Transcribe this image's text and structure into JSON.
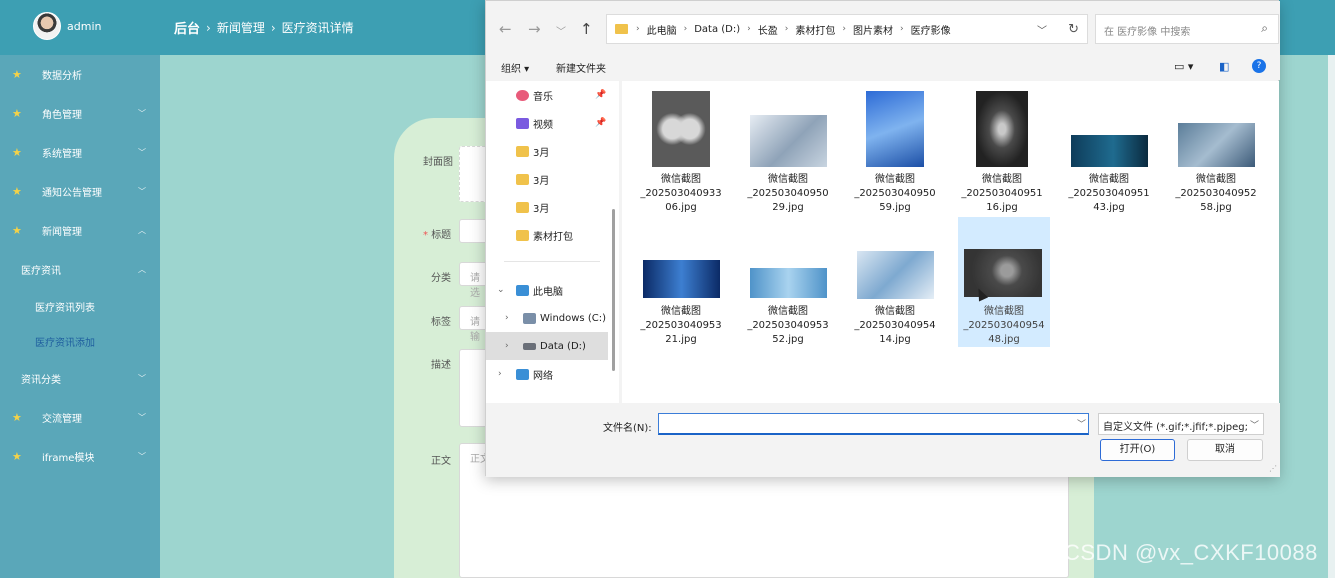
{
  "app": {
    "user_name": "admin",
    "breadcrumb": [
      "后台",
      "新闻管理",
      "医疗资讯详情"
    ]
  },
  "sidebar": {
    "items": [
      {
        "label": "数据分析"
      },
      {
        "label": "角色管理"
      },
      {
        "label": "系统管理"
      },
      {
        "label": "通知公告管理"
      },
      {
        "label": "新闻管理"
      },
      {
        "label": "医疗资讯"
      },
      {
        "label": "医疗资讯列表"
      },
      {
        "label": "医疗资讯添加"
      },
      {
        "label": "资讯分类"
      },
      {
        "label": "交流管理"
      },
      {
        "label": "iframe模块"
      }
    ]
  },
  "form": {
    "cover_label": "封面图",
    "title_label": "标题",
    "category_label": "分类",
    "category_placeholder": "请选",
    "tags_label": "标签",
    "tags_placeholder": "请输",
    "desc_label": "描述",
    "body_label": "正文",
    "body_placeholder": "正文"
  },
  "dialog": {
    "address": [
      "此电脑",
      "Data (D:)",
      "长盈",
      "素材打包",
      "图片素材",
      "医疗影像"
    ],
    "search_placeholder": "在 医疗影像 中搜索",
    "toolbar": {
      "organize": "组织",
      "new_folder": "新建文件夹"
    },
    "nav_items": [
      {
        "label": "音乐",
        "pinned": true
      },
      {
        "label": "视频",
        "pinned": true
      },
      {
        "label": "3月"
      },
      {
        "label": "3月"
      },
      {
        "label": "3月"
      },
      {
        "label": "素材打包"
      },
      {
        "label": "此电脑"
      },
      {
        "label": "Windows (C:)"
      },
      {
        "label": "Data (D:)",
        "selected": true
      },
      {
        "label": "网络"
      }
    ],
    "files": [
      {
        "l1": "微信截图",
        "l2": "_202503040933",
        "l3": "06.jpg"
      },
      {
        "l1": "微信截图",
        "l2": "_202503040950",
        "l3": "29.jpg"
      },
      {
        "l1": "微信截图",
        "l2": "_202503040950",
        "l3": "59.jpg"
      },
      {
        "l1": "微信截图",
        "l2": "_202503040951",
        "l3": "16.jpg"
      },
      {
        "l1": "微信截图",
        "l2": "_202503040951",
        "l3": "43.jpg"
      },
      {
        "l1": "微信截图",
        "l2": "_202503040952",
        "l3": "58.jpg"
      },
      {
        "l1": "微信截图",
        "l2": "_202503040953",
        "l3": "21.jpg"
      },
      {
        "l1": "微信截图",
        "l2": "_202503040953",
        "l3": "52.jpg"
      },
      {
        "l1": "微信截图",
        "l2": "_202503040954",
        "l3": "14.jpg"
      },
      {
        "l1": "微信截图",
        "l2": "_202503040954",
        "l3": "48.jpg",
        "selected": true
      }
    ],
    "filename_label": "文件名(N):",
    "filename_value": "",
    "filetype": "自定义文件 (*.gif;*.jfif;*.pjpeg;",
    "open_button": "打开(O)",
    "cancel_button": "取消"
  },
  "watermark": "CSDN @vx_CXKF10088",
  "colors": {
    "topbar": "#3d9fb3",
    "sidebar": "#5aa7b9",
    "content_bg": "#9dd5cf",
    "accent": "#1a73e8",
    "star": "#f5d247"
  }
}
